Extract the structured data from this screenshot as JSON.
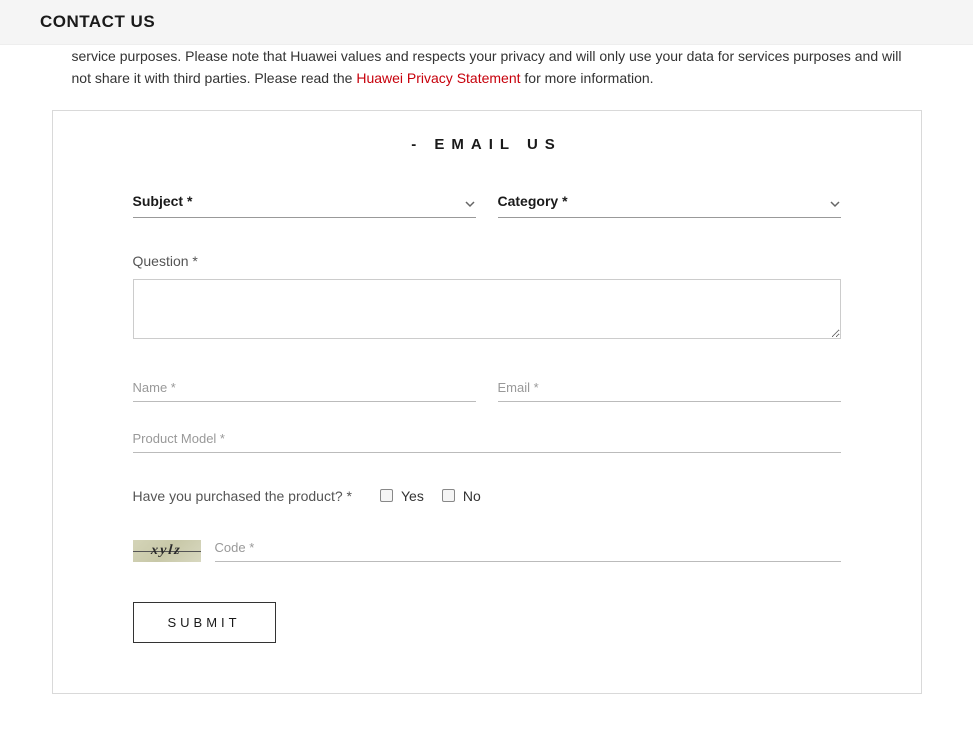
{
  "header": {
    "title": "CONTACT US"
  },
  "intro": {
    "line1": "service purposes. Please note that Huawei values and respects your privacy and will only use your data for services purposes and will not share it with third parties. Please read the ",
    "privacy_link": "Huawei Privacy Statement",
    "line2": " for more information."
  },
  "form": {
    "card_title": "- EMAIL US",
    "subject_label": "Subject *",
    "category_label": "Category *",
    "question_label": "Question *",
    "name_placeholder": "Name *",
    "email_placeholder": "Email *",
    "product_model_placeholder": "Product Model *",
    "purchased_question": "Have you purchased the product? *",
    "option_yes": "Yes",
    "option_no": "No",
    "captcha_text": "xylz",
    "code_placeholder": "Code *",
    "submit_label": "SUBMIT"
  }
}
